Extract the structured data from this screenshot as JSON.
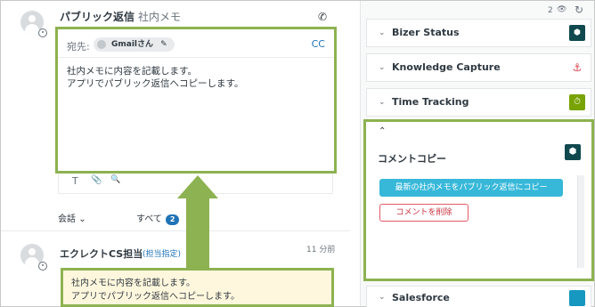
{
  "reply_tabs": {
    "public": "パブリック返信",
    "internal": "社内メモ"
  },
  "composer": {
    "to_label": "宛先:",
    "recipient": "Gmailさん",
    "cc_label": "CC",
    "text": "社内メモに内容を記載します。\nアプリでパブリック返信へコピーします。"
  },
  "toolbar": {
    "text_tool": "T",
    "attach_tool": "📎",
    "search_tool": "🔍"
  },
  "filters": {
    "conversation": "会話",
    "all": "すべて",
    "all_count": "2"
  },
  "comment": {
    "author": "エクレクトCS担当",
    "assign": "(担当指定)",
    "time": "11 分前",
    "text": "社内メモに内容を記載します。\nアプリでパブリック返信へコピーします。"
  },
  "sidebar_top": {
    "count": "2"
  },
  "apps": [
    {
      "name": "Bizer Status",
      "logo_color": "#10494e"
    },
    {
      "name": "Knowledge Capture",
      "logo_color": "#ffffff"
    },
    {
      "name": "Time Tracking",
      "logo_color": "#78a300"
    }
  ],
  "comment_copy_app": {
    "title": "コメントコピー",
    "copy_button": "最新の社内メモをパブリック返信にコピー",
    "delete_button": "コメントを削除"
  },
  "salesforce": {
    "name": "Salesforce",
    "logo_color": "#1798c1"
  },
  "colors": {
    "highlight": "#8db251",
    "primary": "#37b8d9",
    "danger": "#e35b66"
  }
}
